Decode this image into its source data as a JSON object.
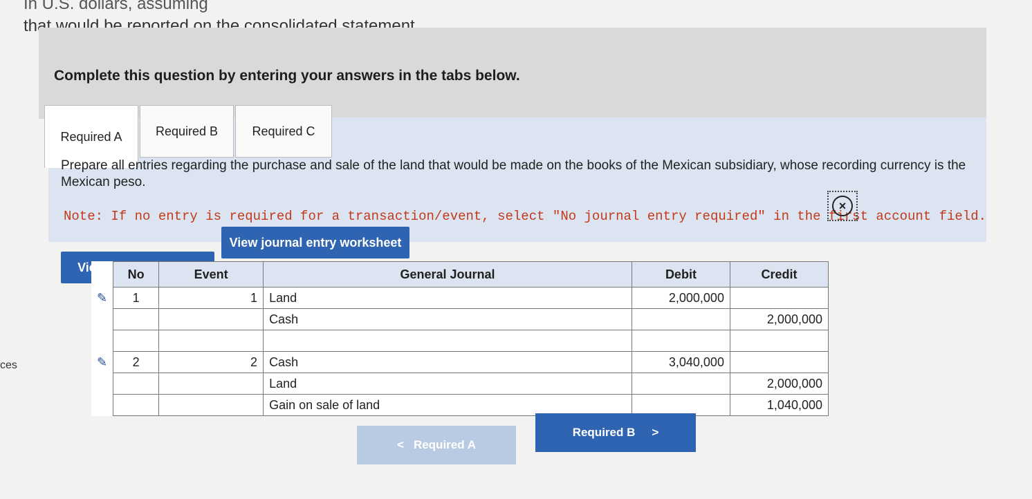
{
  "header": {
    "line1": "In U.S. dollars, assuming",
    "line2": "that would be reported on the consolidated statement"
  },
  "instructions": {
    "label": "Complete this question by entering your answers in the tabs below."
  },
  "tabs": [
    {
      "label": "Required A",
      "active": true
    },
    {
      "label": "Required B",
      "active": false
    },
    {
      "label": "Required C",
      "active": false
    }
  ],
  "prompt": {
    "text": "Prepare all entries regarding the purchase and sale of the land that would be made on the books of the Mexican subsidiary, whose recording currency is the Mexican peso.",
    "note": "Note: If no entry is required for a transaction/event, select \"No journal entry required\" in the first account field."
  },
  "buttons": {
    "view_transaction_list": "View transaction list",
    "view_journal_worksheet": "View journal entry worksheet"
  },
  "journal": {
    "headers": {
      "no": "No",
      "event": "Event",
      "general_journal": "General Journal",
      "debit": "Debit",
      "credit": "Credit"
    },
    "rows": [
      {
        "no": "1",
        "event": "1",
        "account": "Land",
        "debit": "2,000,000",
        "credit": ""
      },
      {
        "no": "",
        "event": "",
        "account": "Cash",
        "debit": "",
        "credit": "2,000,000"
      },
      {
        "no": "",
        "event": "",
        "account": "",
        "debit": "",
        "credit": ""
      },
      {
        "no": "2",
        "event": "2",
        "account": "Cash",
        "debit": "3,040,000",
        "credit": ""
      },
      {
        "no": "",
        "event": "",
        "account": "Land",
        "debit": "",
        "credit": "2,000,000"
      },
      {
        "no": "",
        "event": "",
        "account": "Gain on sale of land",
        "debit": "",
        "credit": "1,040,000"
      }
    ]
  },
  "nav": {
    "prev": "Required A",
    "next": "Required B"
  },
  "side_text": "ces"
}
